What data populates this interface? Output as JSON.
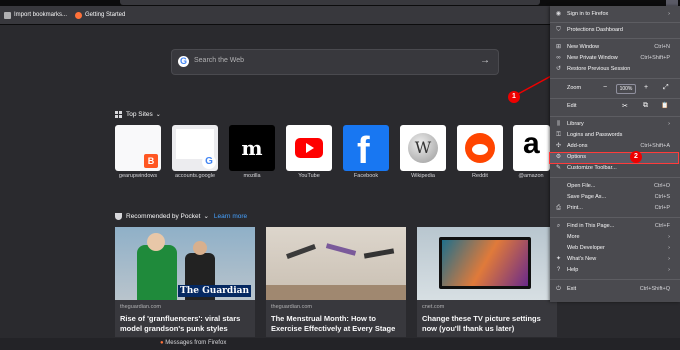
{
  "bookmarks": [
    {
      "label": "Import bookmarks..."
    },
    {
      "label": "Getting Started"
    }
  ],
  "search": {
    "placeholder": "Search the Web"
  },
  "top_sites": {
    "heading": "Top Sites",
    "tiles": [
      {
        "label": "gearupwindows"
      },
      {
        "label": "accounts.google"
      },
      {
        "label": "mozilla"
      },
      {
        "label": "YouTube"
      },
      {
        "label": "Facebook"
      },
      {
        "label": "Wikipedia"
      },
      {
        "label": "Reddit"
      },
      {
        "label": "@amazon"
      }
    ]
  },
  "pocket": {
    "heading": "Recommended by Pocket",
    "learn_more": "Learn more",
    "cards": [
      {
        "source": "theguardian.com",
        "title": "Rise of 'granfluencers': viral stars model grandson's punk styles",
        "overlay": "The Guardian"
      },
      {
        "source": "theguardian.com",
        "title": "The Menstrual Month: How to Exercise Effectively at Every Stage"
      },
      {
        "source": "cnet.com",
        "title": "Change these TV picture settings now (you'll thank us later)"
      }
    ]
  },
  "footer": {
    "message": "Messages from Firefox"
  },
  "menu": {
    "sign_in": "Sign in to Firefox",
    "protections": "Protections Dashboard",
    "new_window": {
      "label": "New Window",
      "shortcut": "Ctrl+N"
    },
    "new_private": {
      "label": "New Private Window",
      "shortcut": "Ctrl+Shift+P"
    },
    "restore": {
      "label": "Restore Previous Session"
    },
    "zoom": {
      "label": "Zoom",
      "minus": "−",
      "value": "100%",
      "plus": "+",
      "fullscreen": "⤢"
    },
    "edit": {
      "label": "Edit",
      "cut": "✂",
      "copy": "⧉",
      "paste": "📋"
    },
    "library": {
      "label": "Library"
    },
    "logins": {
      "label": "Logins and Passwords"
    },
    "addons": {
      "label": "Add-ons",
      "shortcut": "Ctrl+Shift+A"
    },
    "options": {
      "label": "Options"
    },
    "customize": {
      "label": "Customize Toolbar..."
    },
    "open_file": {
      "label": "Open File...",
      "shortcut": "Ctrl+O"
    },
    "save_page": {
      "label": "Save Page As...",
      "shortcut": "Ctrl+S"
    },
    "print": {
      "label": "Print...",
      "shortcut": "Ctrl+P"
    },
    "find": {
      "label": "Find in This Page...",
      "shortcut": "Ctrl+F"
    },
    "more": {
      "label": "More"
    },
    "web_dev": {
      "label": "Web Developer"
    },
    "whats_new": {
      "label": "What's New"
    },
    "help": {
      "label": "Help"
    },
    "exit": {
      "label": "Exit",
      "shortcut": "Ctrl+Shift+Q"
    }
  },
  "annotations": {
    "badge1": "1",
    "badge2": "2"
  },
  "colors": {
    "accent": "#0a84ff",
    "annotation": "#ee0000"
  }
}
